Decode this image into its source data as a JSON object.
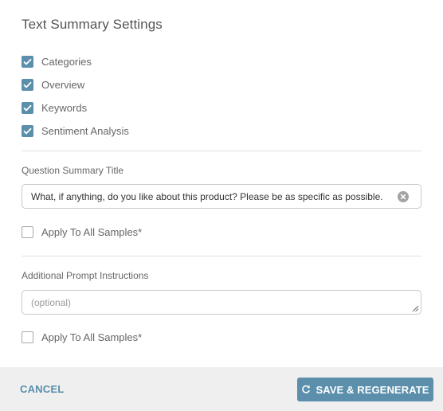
{
  "dialog": {
    "title": "Text Summary Settings",
    "options": [
      {
        "label": "Categories",
        "checked": true
      },
      {
        "label": "Overview",
        "checked": true
      },
      {
        "label": "Keywords",
        "checked": true
      },
      {
        "label": "Sentiment Analysis",
        "checked": true
      }
    ],
    "question_title": {
      "label": "Question Summary Title",
      "value": "What, if anything, do you like about this product? Please be as specific as possible.",
      "apply_all": {
        "label": "Apply To All Samples*",
        "checked": false
      }
    },
    "prompt": {
      "label": "Additional Prompt Instructions",
      "value": "",
      "placeholder": "(optional)",
      "apply_all": {
        "label": "Apply To All Samples*",
        "checked": false
      }
    }
  },
  "footer": {
    "cancel_label": "CANCEL",
    "primary_label": "SAVE & REGENERATE",
    "primary_icon": "refresh-icon"
  },
  "colors": {
    "accent": "#5b8fac",
    "footer_bg": "#efefef",
    "text": "#555555"
  }
}
